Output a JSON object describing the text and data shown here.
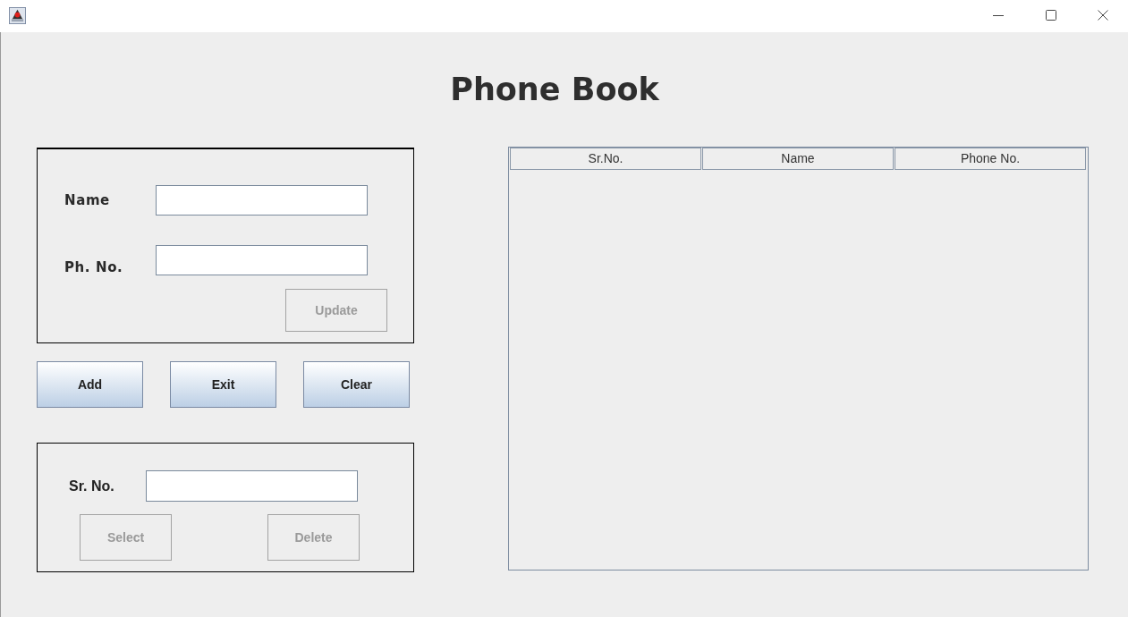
{
  "title": "Phone Book",
  "entry_panel": {
    "fields": [
      {
        "label": "Name"
      },
      {
        "label": "Ph. No."
      }
    ],
    "buttons": [
      {
        "label": "Update",
        "disabled": true
      }
    ]
  },
  "actions": [
    {
      "label": "Add",
      "disabled": false
    },
    {
      "label": "Exit",
      "disabled": false
    },
    {
      "label": "Clear",
      "disabled": false
    }
  ],
  "delete_panel": {
    "field": {
      "label": "Sr. No."
    },
    "buttons": [
      {
        "label": "Select",
        "disabled": true
      },
      {
        "label": "Delete",
        "disabled": true
      }
    ]
  },
  "table": {
    "columns": [
      "Sr.No.",
      "Name",
      "Phone No."
    ]
  }
}
